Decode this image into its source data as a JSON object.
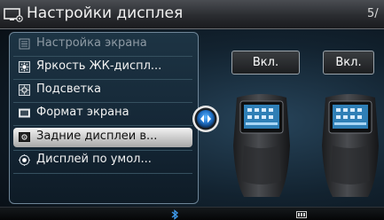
{
  "header": {
    "title": "Настройки дисплея",
    "page": "5/"
  },
  "menu": {
    "items": [
      {
        "label": "Настройка экрана",
        "icon": "screen-settings-icon",
        "state": "disabled"
      },
      {
        "label": "Яркость ЖК-диспл...",
        "icon": "brightness-icon",
        "state": "normal"
      },
      {
        "label": "Подсветка",
        "icon": "backlight-icon",
        "state": "normal"
      },
      {
        "label": "Формат экрана",
        "icon": "screen-format-icon",
        "state": "normal"
      },
      {
        "label": "Задние дисплеи в...",
        "icon": "rear-display-icon",
        "state": "selected"
      },
      {
        "label": "Дисплей по умол...",
        "icon": "default-display-icon",
        "state": "normal"
      }
    ]
  },
  "rear_displays": {
    "left_label": "Вкл.",
    "right_label": "Вкл."
  },
  "colors": {
    "accent": "#2a7fd4",
    "selected": "#d8d8d8",
    "panel_border": "#6e8597"
  }
}
